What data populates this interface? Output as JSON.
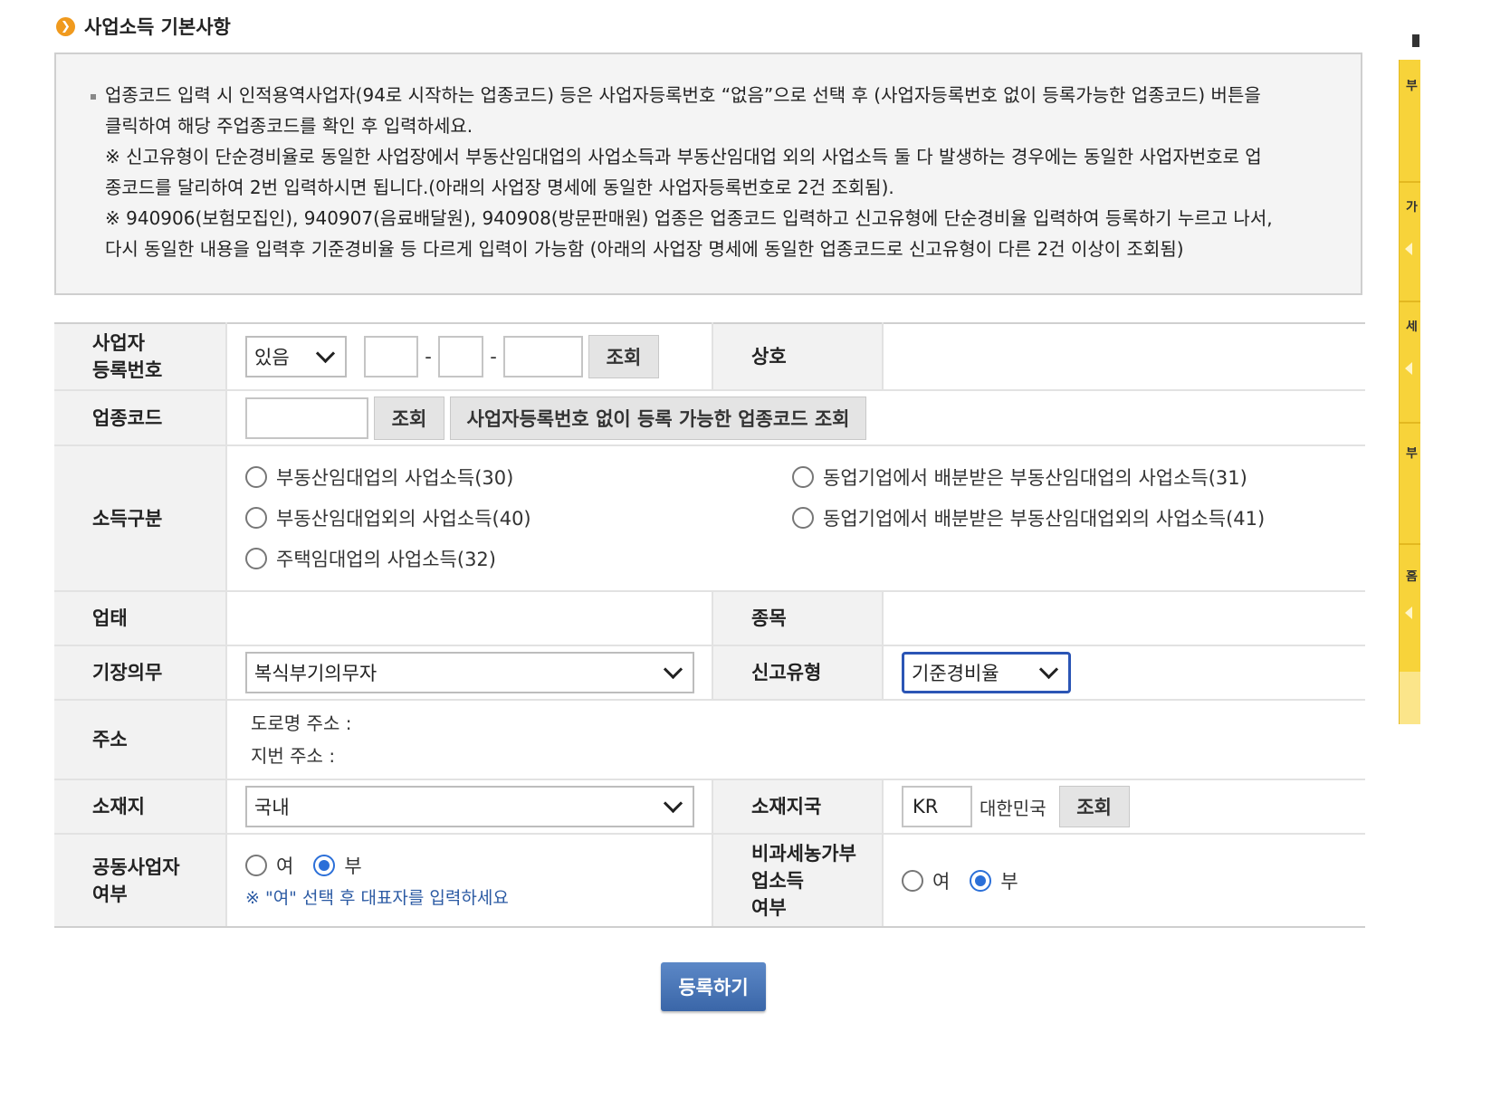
{
  "section": {
    "icon": "arrow-right-circle-icon",
    "title": "사업소득 기본사항"
  },
  "notice": {
    "lines": [
      "업종코드 입력 시 인적용역사업자(94로 시작하는 업종코드) 등은 사업자등록번호 “없음”으로 선택 후 (사업자등록번호 없이 등록가능한 업종코드) 버튼을",
      "클릭하여 해당 주업종코드를 확인 후 입력하세요.",
      "※ 신고유형이 단순경비율로 동일한 사업장에서 부동산임대업의 사업소득과 부동산임대업 외의 사업소득 둘 다 발생하는 경우에는 동일한 사업자번호로 업",
      "종코드를 달리하여 2번 입력하시면 됩니다.(아래의 사업장 명세에 동일한 사업자등록번호로 2건 조회됨).",
      "※ 940906(보험모집인), 940907(음료배달원), 940908(방문판매원) 업종은 업종코드 입력하고 신고유형에 단순경비율 입력하여 등록하기 누르고 나서,",
      "다시 동일한 내용을 입력후 기준경비율 등 다르게 입력이 가능함 (아래의 사업장 명세에 동일한 업종코드로 신고유형이 다른 2건 이상이 조회됨)"
    ]
  },
  "form": {
    "bizno": {
      "label_1": "사업자",
      "label_2": "등록번호",
      "select_value": "있음",
      "dash": "-",
      "search_label": "조회"
    },
    "company": {
      "label": "상호"
    },
    "industry": {
      "label": "업종코드",
      "search_label": "조회",
      "nobiz_label": "사업자등록번호 없이 등록 가능한 업종코드 조회"
    },
    "income_type": {
      "label": "소득구분",
      "options": [
        "부동산임대업의 사업소득(30)",
        "동업기업에서 배분받은 부동산임대업의 사업소득(31)",
        "부동산임대업외의 사업소득(40)",
        "동업기업에서 배분받은 부동산임대업외의 사업소득(41)",
        "주택임대업의 사업소득(32)"
      ]
    },
    "business_type": {
      "label": "업태"
    },
    "item": {
      "label": "종목"
    },
    "bookkeeping": {
      "label": "기장의무",
      "value": "복식부기의무자"
    },
    "report_type": {
      "label": "신고유형",
      "value": "기준경비율"
    },
    "address": {
      "label": "주소",
      "road": "도로명 주소 :",
      "lot": "지번 주소 :"
    },
    "location": {
      "label": "소재지",
      "value": "국내"
    },
    "country": {
      "label": "소재지국",
      "code": "KR",
      "name": "대한민국",
      "search_label": "조회"
    },
    "joint": {
      "label_1": "공동사업자",
      "label_2": "여부",
      "yes": "여",
      "no": "부",
      "selected": "부",
      "hint": "※ \"여\" 선택 후 대표자를 입력하세요"
    },
    "nontax": {
      "label_1": "비과세농가부",
      "label_2": "업소득",
      "label_3": "여부",
      "yes": "여",
      "no": "부",
      "selected": "부"
    }
  },
  "submit_label": "등록하기",
  "sidebar": {
    "glyphs": [
      "부",
      "가",
      "세",
      "부",
      "홈"
    ]
  },
  "colors": {
    "accent": "#2b6fd8",
    "submit": "#3a66a8",
    "notice_bg": "#f4f4f4",
    "label_bg": "#f2f2f2",
    "sidebar": "#f7d33a",
    "icon": "#f09a1e"
  }
}
